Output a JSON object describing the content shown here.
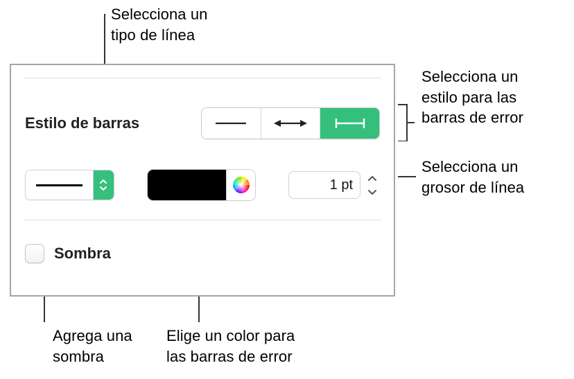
{
  "callouts": {
    "linetype": "Selecciona un\ntipo de línea",
    "style": "Selecciona un\nestilo para las\nbarras de error",
    "thickness": "Selecciona un\ngrosor de línea",
    "shadow": "Agrega una\nsombra",
    "color": "Elige un color para\nlas barras de error"
  },
  "panel": {
    "section_title": "Estilo de barras",
    "error_style_segments": [
      "plain-line",
      "arrow-line",
      "capped-line"
    ],
    "error_style_selected_index": 2,
    "line_thickness": "1 pt",
    "line_color_hex": "#000000",
    "shadow_label": "Sombra",
    "shadow_checked": false
  }
}
